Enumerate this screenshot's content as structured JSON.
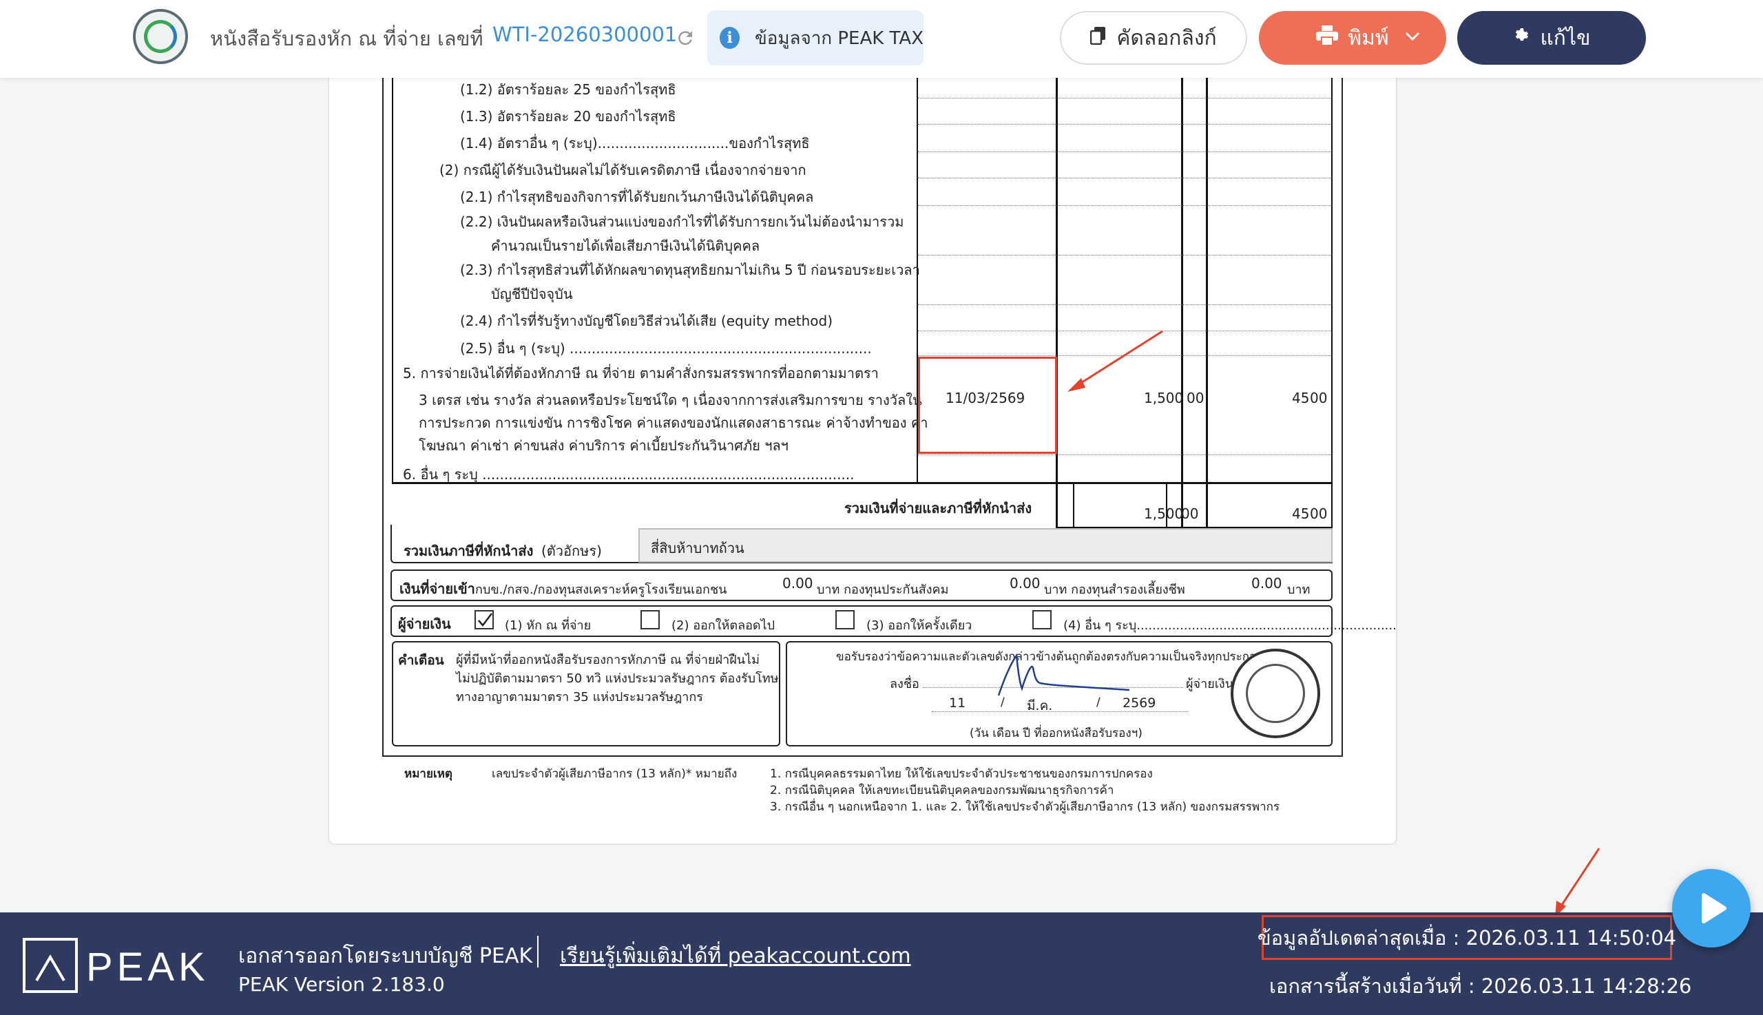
{
  "header": {
    "doc_title": "หนังสือรับรองหัก ณ ที่จ่าย เลขที่",
    "doc_number": "WTI-20260300001",
    "peak_tax_label": "ข้อมูลจาก PEAK TAX",
    "copy_link_label": "คัดลอกลิงก์",
    "print_label": "พิมพ์",
    "edit_label": "แก้ไข"
  },
  "form": {
    "lines": [
      "(1.2) อัตราร้อยละ 25 ของกำไรสุทธิ",
      "(1.3) อัตราร้อยละ 20 ของกำไรสุทธิ",
      "(1.4) อัตราอื่น ๆ (ระบุ)..............................ของกำไรสุทธิ",
      "(2) กรณีผู้ได้รับเงินปันผลไม่ได้รับเครดิตภาษี เนื่องจากจ่ายจาก",
      "(2.1) กำไรสุทธิของกิจการที่ได้รับยกเว้นภาษีเงินได้นิติบุคคล",
      "(2.2) เงินปันผลหรือเงินส่วนแบ่งของกำไรที่ได้รับการยกเว้นไม่ต้องนำมารวม",
      "คำนวณเป็นรายได้เพื่อเสียภาษีเงินได้นิติบุคคล",
      "(2.3) กำไรสุทธิส่วนที่ได้หักผลขาดทุนสุทธิยกมาไม่เกิน 5 ปี ก่อนรอบระยะเวลา",
      "บัญชีปีปัจจุบัน",
      "(2.4) กำไรที่รับรู้ทางบัญชีโดยวิธีส่วนได้เสีย (equity method)",
      "(2.5) อื่น ๆ (ระบุ) .....................................................................",
      "5. การจ่ายเงินได้ที่ต้องหักภาษี ณ ที่จ่าย ตามคำสั่งกรมสรรพากรที่ออกตามมาตรา",
      "3 เตรส เช่น รางวัล ส่วนลดหรือประโยชน์ใด ๆ เนื่องจากการส่งเสริมการขาย รางวัลใน",
      "การประกวด การแข่งขัน การชิงโชค ค่าแสดงของนักแสดงสาธารณะ ค่าจ้างทำของ ค่า",
      "โฆษณา ค่าเช่า ค่าขนส่ง ค่าบริการ ค่าเบี้ยประกันวินาศภัย ฯลฯ",
      "6. อื่น ๆ ระบุ ....................................................................................."
    ],
    "row5": {
      "date": "11/03/2569",
      "amount": "1,500",
      "amount_dec": "00",
      "tax": "45",
      "tax_dec": "00"
    },
    "total_label": "รวมเงินที่จ่ายและภาษีที่หักนำส่ง",
    "total_amount": "1,500",
    "total_amount_dec": "00",
    "total_tax": "45",
    "total_tax_dec": "00",
    "tax_words_label": "รวมเงินภาษีที่หักนำส่ง",
    "tax_words_suffix": "(ตัวอักษร)",
    "tax_words_value": "สี่สิบห้าบาทถ้วน",
    "fund_label": "เงินที่จ่ายเข้า",
    "fund_text1": "กบข./กสจ./กองทุนสงเคราะห์ครูโรงเรียนเอกชน",
    "fund_value1": "0.00",
    "fund_text2": "บาท  กองทุนประกันสังคม",
    "fund_value2": "0.00",
    "fund_text3": "บาท  กองทุนสำรองเลี้ยงชีพ",
    "fund_value3": "0.00",
    "fund_text4": "บาท",
    "payer_label": "ผู้จ่ายเงิน",
    "payer_opt1": "(1)  หัก ณ ที่จ่าย",
    "payer_opt2": "(2)  ออกให้ตลอดไป",
    "payer_opt3": "(3)  ออกให้ครั้งเดียว",
    "payer_opt4": "(4)  อื่น ๆ ระบุ..................................................................",
    "warning_label": "คำเตือน",
    "warning_lines": [
      "ผู้ที่มีหน้าที่ออกหนังสือรับรองการหักภาษี ณ ที่จ่ายฝ่าฝืนไม่",
      "ไม่ปฏิบัติตามมาตรา 50 ทวิ แห่งประมวลรัษฎากร ต้องรับโทษ",
      "ทางอาญาตามมาตรา 35 แห่งประมวลรัษฎากร"
    ],
    "certify_text": "ขอรับรองว่าข้อความและตัวเลขดังกล่าวข้างต้นถูกต้องตรงกับความเป็นจริงทุกประการ",
    "sign_label": "ลงชื่อ",
    "payer_suffix": "ผู้จ่ายเงิน",
    "sign_day": "11",
    "sign_month": "มี.ค.",
    "sign_year": "2569",
    "date_caption": "(วัน เดือน ปี ที่ออกหนังสือรับรองฯ)",
    "note_label": "หมายเหตุ",
    "note_text": "เลขประจำตัวผู้เสียภาษีอากร (13 หลัก)* หมายถึง",
    "note_items": [
      "1. กรณีบุคคลธรรมดาไทย ให้ใช้เลขประจำตัวประชาชนของกรมการปกครอง",
      "2. กรณีนิติบุคคล ให้เลขทะเบียนนิติบุคคลของกรมพัฒนาธุรกิจการค้า",
      "3. กรณีอื่น ๆ นอกเหนือจาก 1. และ 2. ให้ใช้เลขประจำตัวผู้เสียภาษีอากร (13 หลัก) ของกรมสรรพากร"
    ]
  },
  "footer": {
    "logo_text": "PEAK",
    "issued_by": "เอกสารออกโดยระบบบัญชี PEAK",
    "version": "PEAK Version 2.183.0",
    "learn_more": "เรียนรู้เพิ่มเติมได้ที่ peakaccount.com",
    "updated": "ข้อมูลอัปเดตล่าสุดเมื่อ : 2026.03.11 14:50:04",
    "created": "เอกสารนี้สร้างเมื่อวันที่ : 2026.03.11 14:28:26"
  },
  "colors": {
    "primary_navy": "#2e3a5f",
    "print_orange": "#ee6f55",
    "link_blue": "#3b8fd8",
    "highlight_red": "#e2432c"
  },
  "icons": {
    "refresh": "refresh-icon",
    "info": "info-icon",
    "copy": "copy-icon",
    "print": "printer-icon",
    "caret": "chevron-down-icon",
    "edit": "gear-icon",
    "play": "play-icon"
  }
}
